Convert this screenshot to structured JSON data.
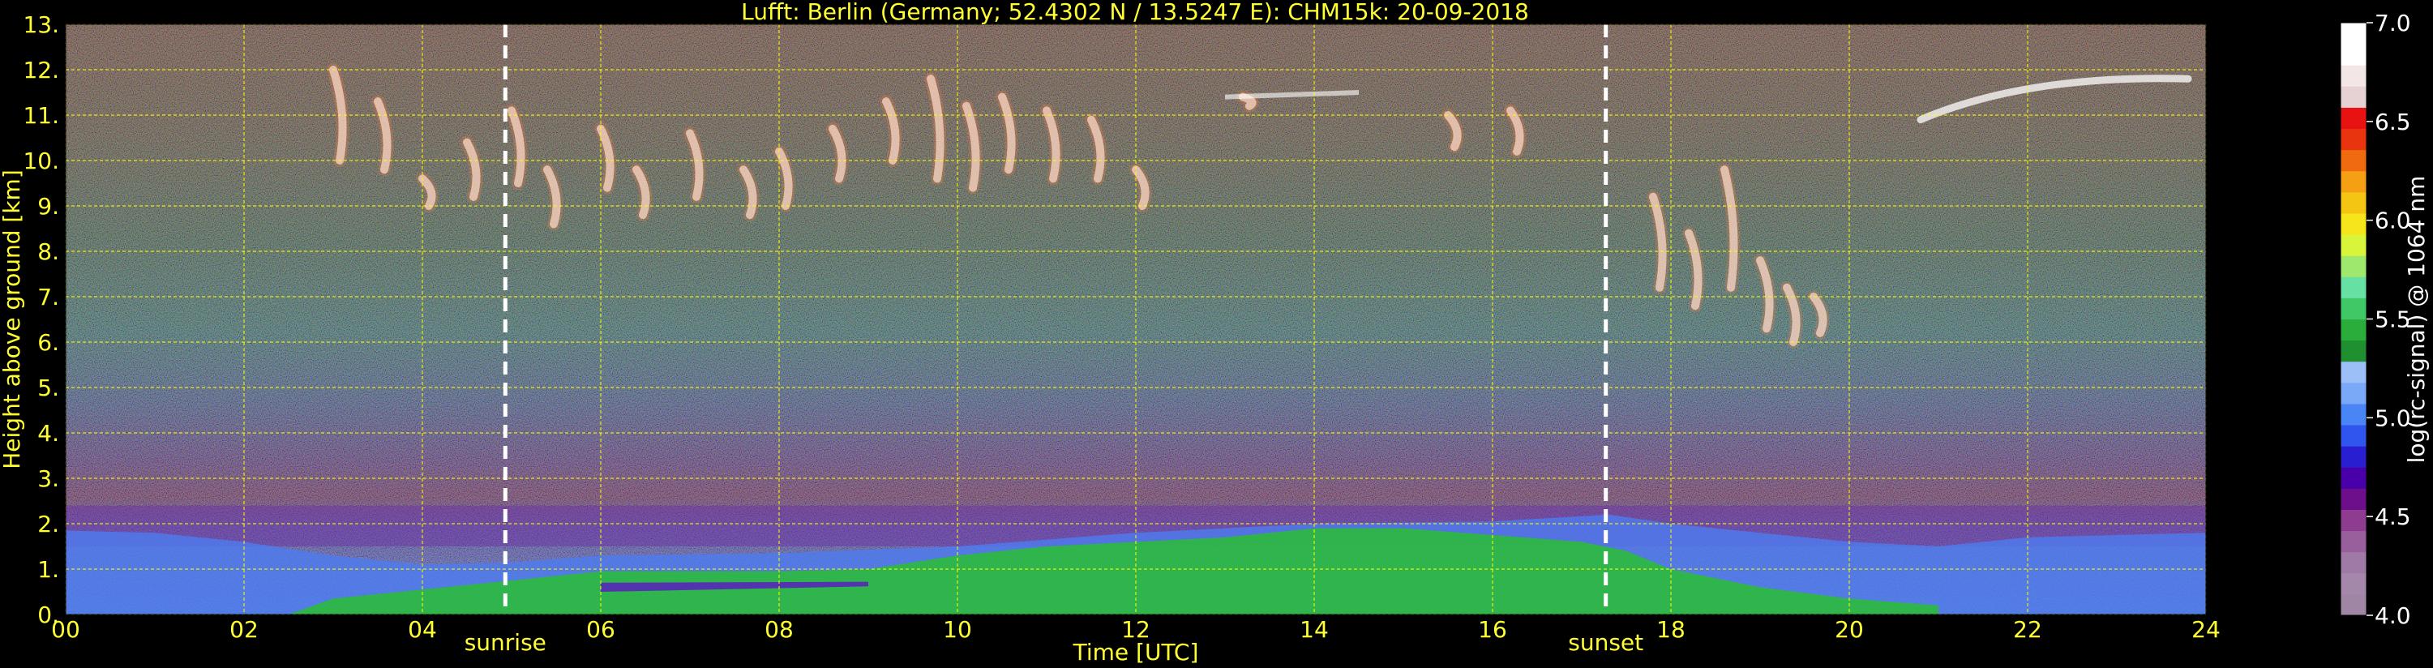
{
  "chart_data": {
    "type": "heatmap",
    "title": "Lufft: Berlin (Germany; 52.4302 N / 13.5247 E):    CHM15k: 20-09-2018",
    "xlabel": "Time [UTC]",
    "ylabel": "Height above ground [km]",
    "xlim": [
      0,
      24
    ],
    "ylim": [
      0,
      13
    ],
    "x_ticks": [
      "00",
      "02",
      "04",
      "06",
      "08",
      "10",
      "12",
      "14",
      "16",
      "18",
      "20",
      "22",
      "24"
    ],
    "y_ticks": [
      "0.",
      "1.",
      "2.",
      "3.",
      "4.",
      "5.",
      "6.",
      "7.",
      "8.",
      "9.",
      "10.",
      "11.",
      "12.",
      "13."
    ],
    "grid": true,
    "grid_color": "#ffff00",
    "events": [
      {
        "label": "sunrise",
        "time": 4.93
      },
      {
        "label": "sunset",
        "time": 17.27
      }
    ],
    "colorbar": {
      "label": "log(rc-signal) @ 1064 nm",
      "range": [
        4.0,
        7.0
      ],
      "ticks": [
        "4.0",
        "4.5",
        "5.0",
        "5.5",
        "6.0",
        "6.5",
        "7.0"
      ],
      "colors": [
        "#9f86a5",
        "#a587ab",
        "#a07aa6",
        "#995f9c",
        "#8d3c8f",
        "#6d0f8a",
        "#4a00a8",
        "#2a1fd0",
        "#2f55ee",
        "#4a85f5",
        "#7aaaf7",
        "#9cbff8",
        "#1f8f2f",
        "#2aad3a",
        "#40c867",
        "#66e0a3",
        "#9ee86d",
        "#d9f53a",
        "#f5e51a",
        "#f5c514",
        "#f5a012",
        "#f06a10",
        "#e93410",
        "#e81212",
        "#e6d2d2",
        "#f2e6e6",
        "#ffffff",
        "#ffffff"
      ]
    },
    "layers": [
      {
        "name": "boundary-layer-blue",
        "color": "#4d7cf0"
      },
      {
        "name": "aerosol-green",
        "color": "#2cba3c"
      },
      {
        "name": "residual-purple",
        "color": "#6a2ca6"
      },
      {
        "name": "cirrus-clouds",
        "color": "#ffffff"
      }
    ]
  }
}
